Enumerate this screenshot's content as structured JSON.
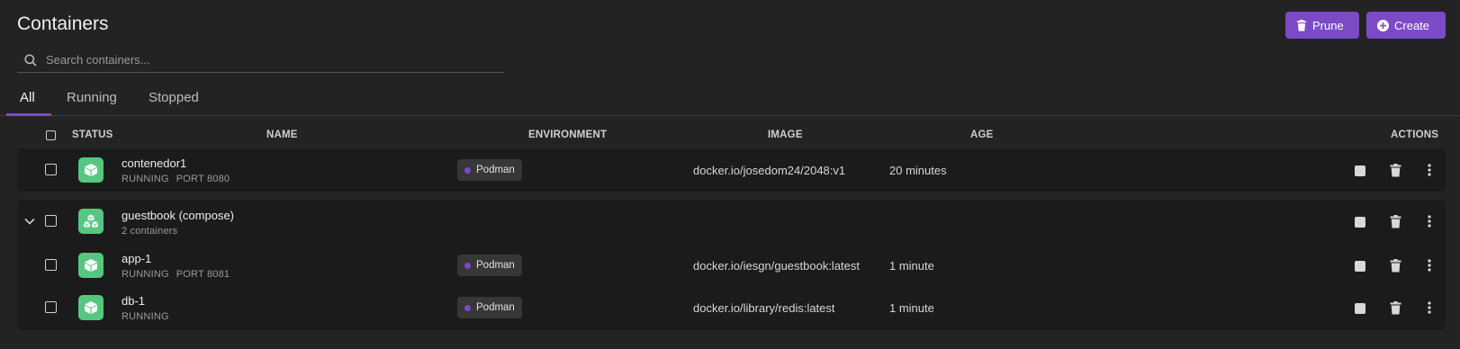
{
  "page": {
    "title": "Containers"
  },
  "toolbar": {
    "prune_label": "Prune",
    "create_label": "Create"
  },
  "search": {
    "placeholder": "Search containers..."
  },
  "tabs": [
    {
      "label": "All",
      "active": true
    },
    {
      "label": "Running",
      "active": false
    },
    {
      "label": "Stopped",
      "active": false
    }
  ],
  "columns": {
    "status": "STATUS",
    "name": "NAME",
    "environment": "ENVIRONMENT",
    "image": "IMAGE",
    "age": "AGE",
    "actions": "ACTIONS"
  },
  "containers": [
    {
      "name": "contenedor1",
      "state": "RUNNING",
      "port": "PORT 8080",
      "environment": "Podman",
      "image": "docker.io/josedom24/2048:v1",
      "age": "20 minutes"
    }
  ],
  "group": {
    "name": "guestbook (compose)",
    "summary": "2 containers",
    "children": [
      {
        "name": "app-1",
        "state": "RUNNING",
        "port": "PORT 8081",
        "environment": "Podman",
        "image": "docker.io/iesgn/guestbook:latest",
        "age": "1 minute"
      },
      {
        "name": "db-1",
        "state": "RUNNING",
        "environment": "Podman",
        "image": "docker.io/library/redis:latest",
        "age": "1 minute"
      }
    ]
  },
  "colors": {
    "accent": "#7c4ac7",
    "status_running": "#55c781",
    "background": "#232323",
    "card": "#1b1b1b"
  },
  "icons": {
    "prune": "trash-icon",
    "create": "plus-circle-icon",
    "search": "search-icon",
    "container": "box-icon",
    "pod": "boxes-icon",
    "stop": "stop-icon",
    "delete": "trash-icon",
    "menu": "kebab-menu-icon",
    "expand": "chevron-down-icon"
  }
}
